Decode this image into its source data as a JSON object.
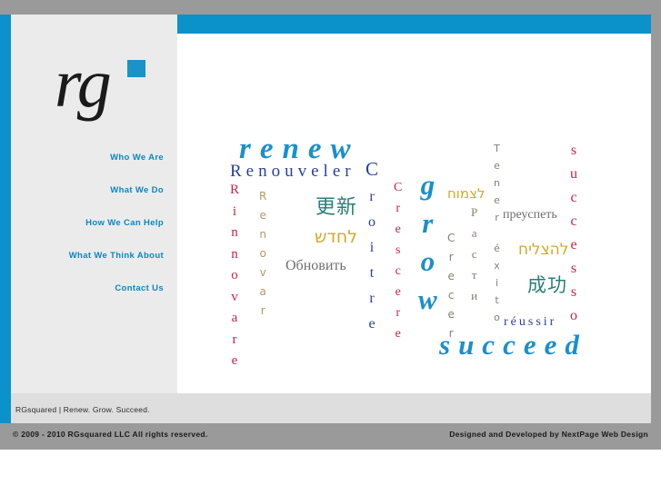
{
  "brand": {
    "logo_text": "rg",
    "logo_square_color": "#1a93c9",
    "accent_blue": "#0b92ca",
    "tagline": "RGsquared | Renew.  Grow.  Succeed."
  },
  "nav": {
    "items": [
      {
        "label": "Who We Are"
      },
      {
        "label": "What We Do"
      },
      {
        "label": "How We Can Help"
      },
      {
        "label": "What We Think About"
      },
      {
        "label": "Contact Us"
      }
    ]
  },
  "word_cloud": {
    "headline_words": [
      {
        "text": "renew",
        "color": "#1a8fcc"
      },
      {
        "text": "grow",
        "color": "#1a8fcc"
      },
      {
        "text": "succeed",
        "color": "#1a8fcc"
      }
    ],
    "words": [
      {
        "text": "renew",
        "lang": "English",
        "color": "#1a8fcc"
      },
      {
        "text": "Renouveler",
        "lang": "French",
        "color": "#2a3fa0"
      },
      {
        "text": "Rinnovare",
        "lang": "Italian",
        "color": "#c9234b"
      },
      {
        "text": "Renovar",
        "lang": "Spanish",
        "color": "#b39a63"
      },
      {
        "text": "更新",
        "lang": "Chinese",
        "color": "#2a7f7a"
      },
      {
        "text": "לחדש",
        "lang": "Hebrew",
        "color": "#d4a92b"
      },
      {
        "text": "Обновить",
        "lang": "Russian",
        "color": "#6e6e6e"
      },
      {
        "text": "Croitre",
        "lang": "French",
        "color": "#2a3fa0"
      },
      {
        "text": "Crescere",
        "lang": "Italian",
        "color": "#c9234b"
      },
      {
        "text": "grow",
        "lang": "English",
        "color": "#1a8fcc"
      },
      {
        "text": "לצמוח",
        "lang": "Hebrew",
        "color": "#d4a92b"
      },
      {
        "text": "Crecer",
        "lang": "Spanish",
        "color": "#8a8070"
      },
      {
        "text": "Расти",
        "lang": "Russian",
        "color": "#8a8070"
      },
      {
        "text": "Tener éxito",
        "lang": "Spanish",
        "color": "#8a8070"
      },
      {
        "text": "преуспеть",
        "lang": "Russian",
        "color": "#6e6e6e"
      },
      {
        "text": "להצליח",
        "lang": "Hebrew",
        "color": "#d4a92b"
      },
      {
        "text": "成功",
        "lang": "Chinese",
        "color": "#2a7f7a"
      },
      {
        "text": "Successo",
        "lang": "Italian",
        "color": "#c9234b"
      },
      {
        "text": "réussir",
        "lang": "French",
        "color": "#2a3fa0"
      },
      {
        "text": "succeed",
        "lang": "English",
        "color": "#1a8fcc"
      }
    ],
    "letters": {
      "rinnovare": [
        "R",
        "i",
        "n",
        "n",
        "o",
        "v",
        "a",
        "r",
        "e"
      ],
      "renovar": [
        "R",
        "e",
        "n",
        "o",
        "v",
        "a",
        "r"
      ],
      "croitre": [
        "C",
        "r",
        "o",
        "i",
        "t",
        "r",
        "e"
      ],
      "crescere": [
        "C",
        "r",
        "e",
        "s",
        "c",
        "e",
        "r",
        "e"
      ],
      "crecer": [
        "C",
        "r",
        "e",
        "c",
        "e",
        "r"
      ],
      "rasti": [
        "Р",
        "а",
        "с",
        "т",
        "и"
      ],
      "tenerexito": [
        "T",
        "e",
        "n",
        "e",
        "r",
        "",
        "é",
        "x",
        "i",
        "t",
        "o"
      ],
      "successo": [
        "S",
        "u",
        "c",
        "c",
        "e",
        "s",
        "s",
        "o"
      ]
    }
  },
  "footer": {
    "tagline": "RGsquared | Renew.  Grow.  Succeed.",
    "copyright": "© 2009 - 2010 RGsquared LLC All rights reserved.",
    "credit": "Designed and Developed by NextPage Web Design"
  }
}
